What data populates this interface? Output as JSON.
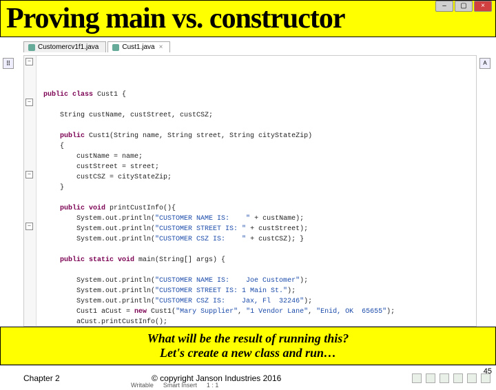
{
  "slide": {
    "title": "Proving main vs. constructor",
    "question_line1": "What will be the result of running this?",
    "question_line2": "Let's create a new class and run…",
    "chapter": "Chapter 2",
    "copyright": "© copyright Janson Industries 2016",
    "slide_number": "45"
  },
  "window": {
    "min": "–",
    "max": "▢",
    "close": "×"
  },
  "tabs": [
    {
      "label": "Customercv1f1.java",
      "active": false
    },
    {
      "label": "Cust1.java",
      "active": true
    }
  ],
  "code": {
    "l1a": "public class",
    "l1b": " Cust1 {",
    "l2": "    String custName, custStreet, custCSZ;",
    "l3a": "    public",
    "l3b": " Cust1(String name, String street, String cityStateZip)",
    "l4": "    {",
    "l5": "        custName = name;",
    "l6": "        custStreet = street;",
    "l7": "        custCSZ = cityStateZip;",
    "l8": "    }",
    "l9a": "    public void",
    "l9b": " printCustInfo(){",
    "l10a": "        System.out.println(",
    "l10s": "\"CUSTOMER NAME IS:    \"",
    "l10b": " + custName);",
    "l11a": "        System.out.println(",
    "l11s": "\"CUSTOMER STREET IS: \"",
    "l11b": " + custStreet);",
    "l12a": "        System.out.println(",
    "l12s": "\"CUSTOMER CSZ IS:    \"",
    "l12b": " + custCSZ); }",
    "l13a": "    public static void",
    "l13b": " main(String[] args) {",
    "l14a": "        System.out.println(",
    "l14s": "\"CUSTOMER NAME IS:    Joe Customer\"",
    "l14b": ");",
    "l15a": "        System.out.println(",
    "l15s": "\"CUSTOMER STREET IS: 1 Main St.\"",
    "l15b": ");",
    "l16a": "        System.out.println(",
    "l16s": "\"CUSTOMER CSZ IS:    Jax, Fl  32246\"",
    "l16b": ");",
    "l17a": "        Cust1 aCust = ",
    "l17k": "new",
    "l17b": " Cust1(",
    "l17s1": "\"Mary Supplier\"",
    "l17c": ", ",
    "l17s2": "\"1 Vendor Lane\"",
    "l17d": ", ",
    "l17s3": "\"Enid, OK  65655\"",
    "l17e": ");",
    "l18": "        aCust.printCustInfo();"
  },
  "status": {
    "writable": "Writable",
    "insert": "Smart Insert",
    "pos": "1 : 1"
  }
}
